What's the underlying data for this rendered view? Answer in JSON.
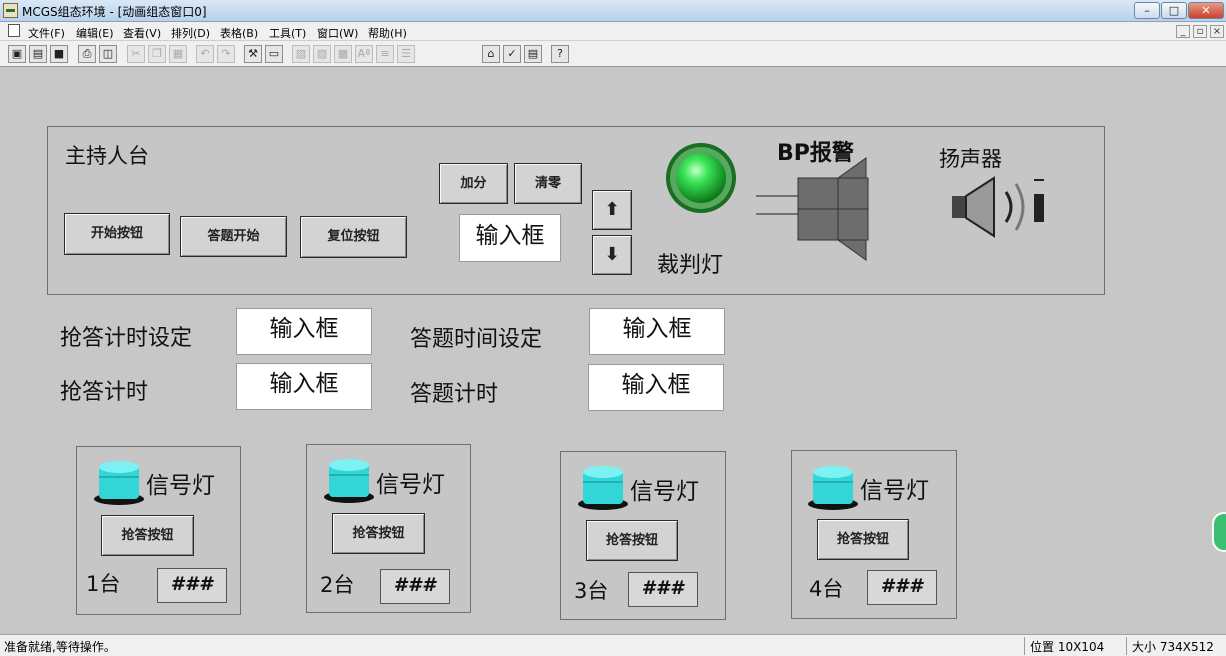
{
  "window": {
    "title": "MCGS组态环境 - [动画组态窗口0]"
  },
  "window_controls": {
    "minimize": "–",
    "maximize": "□",
    "close": "✕",
    "mdi_minimize": "_",
    "mdi_restore": "▫",
    "mdi_close": "×"
  },
  "menubar": {
    "items": [
      "文件(F)",
      "编辑(E)",
      "查看(V)",
      "排列(D)",
      "表格(B)",
      "工具(T)",
      "窗口(W)",
      "帮助(H)"
    ]
  },
  "toolbar": {
    "icons": [
      "new-window-icon",
      "open-icon",
      "save-icon",
      "print-icon",
      "print-preview-icon",
      "cut-icon",
      "copy-icon",
      "paste-icon",
      "undo-icon",
      "redo-icon",
      "tools-icon",
      "frame-icon",
      "align-icon",
      "layer-icon",
      "font-icon",
      "text-icon",
      "list-icon",
      "menu-icon",
      "properties-icon",
      "check-icon",
      "window-icon",
      "help-icon"
    ]
  },
  "host_panel": {
    "title": "主持人台",
    "start_button": "开始按钮",
    "answer_start_button": "答题开始",
    "reset_button": "复位按钮",
    "add_score_button": "加分",
    "clear_button": "清零",
    "input_box": "输入框",
    "up_arrow": "⬆",
    "down_arrow": "⬇",
    "judge_light_label": "裁判灯",
    "bp_alarm_label": "BP报警",
    "speaker_label": "扬声器"
  },
  "settings": {
    "grab_time_setting_label": "抢答计时设定",
    "grab_time_setting_value": "输入框",
    "answer_time_setting_label": "答题时间设定",
    "answer_time_setting_value": "输入框",
    "grab_timer_label": "抢答计时",
    "grab_timer_value": "输入框",
    "answer_timer_label": "答题计时",
    "answer_timer_value": "输入框"
  },
  "stations": [
    {
      "signal_label": "信号灯",
      "button_label": "抢答按钮",
      "station_label": "1台",
      "value": "###"
    },
    {
      "signal_label": "信号灯",
      "button_label": "抢答按钮",
      "station_label": "2台",
      "value": "###"
    },
    {
      "signal_label": "信号灯",
      "button_label": "抢答按钮",
      "station_label": "3台",
      "value": "###"
    },
    {
      "signal_label": "信号灯",
      "button_label": "抢答按钮",
      "station_label": "4台",
      "value": "###"
    }
  ],
  "statusbar": {
    "message": "准备就绪,等待操作。",
    "position": "位置 10X104",
    "size": "大小 734X512"
  },
  "colors": {
    "judge_light": "#23c43a",
    "signal_light": "#33d6d6",
    "canvas_bg": "#c7c7c7",
    "alarm_gray": "#6d6d6d"
  }
}
